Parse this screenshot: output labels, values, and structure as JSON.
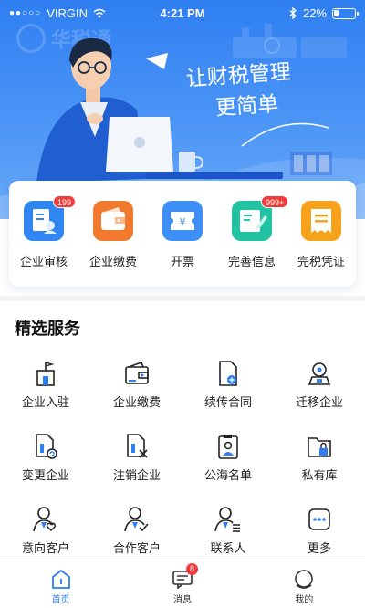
{
  "status_bar": {
    "signal": "●●○○○",
    "carrier": "VIRGIN",
    "time": "4:21 PM",
    "battery": "22%"
  },
  "banner": {
    "brand_watermark": "华税通",
    "slogan_line1": "让财税管理",
    "slogan_line2": "更简单"
  },
  "quick_actions": [
    {
      "label": "企业审核",
      "icon": "document-person-icon",
      "color": "#2f86f0",
      "badge": "199"
    },
    {
      "label": "企业缴费",
      "icon": "wallet-icon",
      "color": "#f27a2e",
      "badge": ""
    },
    {
      "label": "开票",
      "icon": "ticket-yen-icon",
      "color": "#3d8ff5",
      "badge": ""
    },
    {
      "label": "完善信息",
      "icon": "edit-card-icon",
      "color": "#22c3a3",
      "badge": "999+"
    },
    {
      "label": "完税凭证",
      "icon": "receipt-icon",
      "color": "#f7a21b",
      "badge": ""
    }
  ],
  "services": {
    "title": "精选服务",
    "items": [
      {
        "label": "企业入驻",
        "icon": "building-flag-icon"
      },
      {
        "label": "企业缴费",
        "icon": "wallet-icon"
      },
      {
        "label": "续传合同",
        "icon": "contract-add-icon"
      },
      {
        "label": "迁移企业",
        "icon": "relocate-icon"
      },
      {
        "label": "变更企业",
        "icon": "file-change-icon"
      },
      {
        "label": "注销企业",
        "icon": "file-cancel-icon"
      },
      {
        "label": "公海名单",
        "icon": "clipboard-person-icon"
      },
      {
        "label": "私有库",
        "icon": "folder-lock-icon"
      },
      {
        "label": "意向客户",
        "icon": "person-heart-icon"
      },
      {
        "label": "合作客户",
        "icon": "person-check-icon"
      },
      {
        "label": "联系人",
        "icon": "person-list-icon"
      },
      {
        "label": "更多",
        "icon": "more-dots-icon"
      }
    ]
  },
  "tabbar": [
    {
      "label": "首页",
      "icon": "home-icon",
      "active": true,
      "badge": ""
    },
    {
      "label": "消息",
      "icon": "message-icon",
      "active": false,
      "badge": "8"
    },
    {
      "label": "我的",
      "icon": "profile-icon",
      "active": false,
      "badge": ""
    }
  ],
  "colors": {
    "accent": "#2f7ff2",
    "icon_stroke": "#222222",
    "icon_accent": "#2f7ff2",
    "badge": "#f23b3b"
  }
}
